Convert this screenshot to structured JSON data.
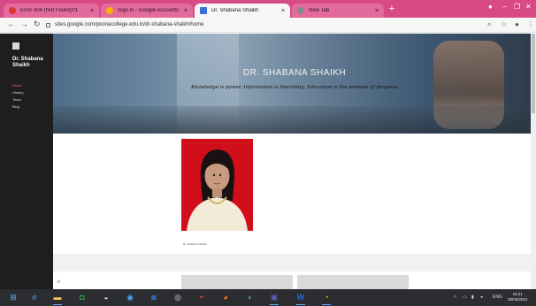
{
  "browser": {
    "tabs": [
      {
        "title": "Error 404 (Not Found)!!1",
        "icon_color": "#d33"
      },
      {
        "title": "Sign in - Google Accounts",
        "icon_color": "#f4b400"
      },
      {
        "title": "Dr. Shabana Shaikh",
        "icon_color": "#3b6fd8",
        "active": true
      },
      {
        "title": "New Tab",
        "icon_color": "#888"
      }
    ],
    "url": "sites.google.com/poonacollege.edu.in/dr-shabana-shaikh/home",
    "close_glyph": "×",
    "new_tab_glyph": "+"
  },
  "site": {
    "title": "Dr. Shabana Shaikh",
    "nav": [
      {
        "label": "Home",
        "active": true
      },
      {
        "label": "History"
      },
      {
        "label": "Team"
      },
      {
        "label": "Blog"
      }
    ],
    "hero_title": "DR. SHABANA SHAIKH",
    "hero_quote": "Knowledge is power. Information is liberating. Education is the premise of progress",
    "photo_caption": "Dr. Shabana Shaikh"
  },
  "taskbar": {
    "tray_language": "ENG",
    "time": "15:21",
    "date": "30/06/2021"
  },
  "colors": {
    "tab_strip": "#d84a86",
    "sidebar": "#1e1e1e",
    "photo_bg": "#d10f1a",
    "active_nav": "#ff6a6a"
  }
}
